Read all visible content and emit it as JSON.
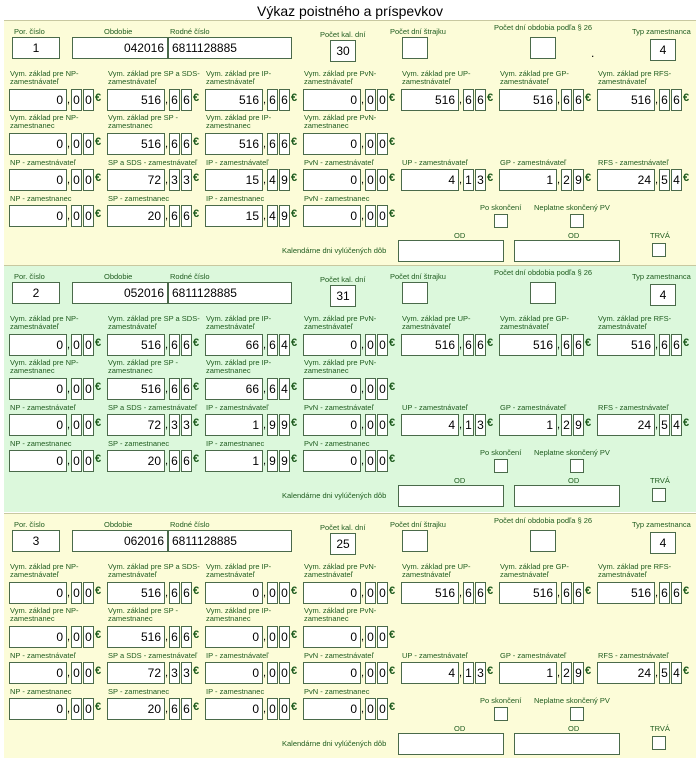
{
  "title": "Výkaz poistného a príspevkov",
  "labels": {
    "por_cislo": "Por. číslo",
    "obdobie": "Obdobie",
    "rodne_cislo": "Rodné číslo",
    "pocet_kal_dni": "Počet kal. dní",
    "pocet_dni_strajku": "Počet dní štrajku",
    "pocet_dni_26": "Počet dní obdobia podľa § 26",
    "typ_zamestnanca": "Typ zamestnanca",
    "zam_row1": [
      "Vym. základ pre NP-zamestnávateľ",
      "Vym. základ pre SP a SDS-zamestnávateľ",
      "Vym. základ pre IP-zamestnávateľ",
      "Vym. základ pre PvN-zamestnávateľ",
      "Vym. základ pre UP-zamestnávateľ",
      "Vym. základ pre GP-zamestnávateľ",
      "Vym. základ pre RFS-zamestnávateľ"
    ],
    "zam_row2": [
      "Vym. základ pre NP-zamestnanec",
      "Vym. základ pre SP - zamestnanec",
      "Vym. základ pre IP-zamestnanec",
      "Vym. základ pre PvN-zamestnanec"
    ],
    "zam_row3": [
      "NP - zamestnávateľ",
      "SP a SDS - zamestnávateľ",
      "IP - zamestnávateľ",
      "PvN - zamestnávateľ",
      "UP - zamestnávateľ",
      "GP - zamestnávateľ",
      "RFS - zamestnávateľ"
    ],
    "zam_row4": [
      "NP - zamestnanec",
      "SP - zamestnanec",
      "IP - zamestnanec",
      "PvN - zamestnanec"
    ],
    "po_skonceni": "Po skončení",
    "neplatne": "Neplatne skončený PV",
    "od": "OD",
    "trva": "TRVÁ",
    "kalendarne": "Kalendárne dni vylúčených dôb",
    "euro": "€"
  },
  "records": [
    {
      "por": "1",
      "obdobie": "042016",
      "rodne": "6811128885",
      "kal_dni": "30",
      "strajk": "",
      "dni26": "",
      "dot": ".",
      "typ": "4",
      "row1": [
        [
          "0",
          "0",
          "0"
        ],
        [
          "516",
          "6",
          "6"
        ],
        [
          "516",
          "6",
          "6"
        ],
        [
          "0",
          "0",
          "0"
        ],
        [
          "516",
          "6",
          "6"
        ],
        [
          "516",
          "6",
          "6"
        ],
        [
          "516",
          "6",
          "6"
        ]
      ],
      "row2": [
        [
          "0",
          "0",
          "0"
        ],
        [
          "516",
          "6",
          "6"
        ],
        [
          "516",
          "6",
          "6"
        ],
        [
          "0",
          "0",
          "0"
        ]
      ],
      "row3": [
        [
          "0",
          "0",
          "0"
        ],
        [
          "72",
          "3",
          "3"
        ],
        [
          "15",
          "4",
          "9"
        ],
        [
          "0",
          "0",
          "0"
        ],
        [
          "4",
          "1",
          "3"
        ],
        [
          "1",
          "2",
          "9"
        ],
        [
          "24",
          "5",
          "4"
        ]
      ],
      "row4": [
        [
          "0",
          "0",
          "0"
        ],
        [
          "20",
          "6",
          "6"
        ],
        [
          "15",
          "4",
          "9"
        ],
        [
          "0",
          "0",
          "0"
        ]
      ]
    },
    {
      "por": "2",
      "obdobie": "052016",
      "rodne": "6811128885",
      "kal_dni": "31",
      "strajk": "",
      "dni26": "",
      "dot": "",
      "typ": "4",
      "row1": [
        [
          "0",
          "0",
          "0"
        ],
        [
          "516",
          "6",
          "6"
        ],
        [
          "66",
          "6",
          "4"
        ],
        [
          "0",
          "0",
          "0"
        ],
        [
          "516",
          "6",
          "6"
        ],
        [
          "516",
          "6",
          "6"
        ],
        [
          "516",
          "6",
          "6"
        ]
      ],
      "row2": [
        [
          "0",
          "0",
          "0"
        ],
        [
          "516",
          "6",
          "6"
        ],
        [
          "66",
          "6",
          "4"
        ],
        [
          "0",
          "0",
          "0"
        ]
      ],
      "row3": [
        [
          "0",
          "0",
          "0"
        ],
        [
          "72",
          "3",
          "3"
        ],
        [
          "1",
          "9",
          "9"
        ],
        [
          "0",
          "0",
          "0"
        ],
        [
          "4",
          "1",
          "3"
        ],
        [
          "1",
          "2",
          "9"
        ],
        [
          "24",
          "5",
          "4"
        ]
      ],
      "row4": [
        [
          "0",
          "0",
          "0"
        ],
        [
          "20",
          "6",
          "6"
        ],
        [
          "1",
          "9",
          "9"
        ],
        [
          "0",
          "0",
          "0"
        ]
      ]
    },
    {
      "por": "3",
      "obdobie": "062016",
      "rodne": "6811128885",
      "kal_dni": "25",
      "strajk": "",
      "dni26": "",
      "dot": "",
      "typ": "4",
      "row1": [
        [
          "0",
          "0",
          "0"
        ],
        [
          "516",
          "6",
          "6"
        ],
        [
          "0",
          "0",
          "0"
        ],
        [
          "0",
          "0",
          "0"
        ],
        [
          "516",
          "6",
          "6"
        ],
        [
          "516",
          "6",
          "6"
        ],
        [
          "516",
          "6",
          "6"
        ]
      ],
      "row2": [
        [
          "0",
          "0",
          "0"
        ],
        [
          "516",
          "6",
          "6"
        ],
        [
          "0",
          "0",
          "0"
        ],
        [
          "0",
          "0",
          "0"
        ]
      ],
      "row3": [
        [
          "0",
          "0",
          "0"
        ],
        [
          "72",
          "3",
          "3"
        ],
        [
          "0",
          "0",
          "0"
        ],
        [
          "0",
          "0",
          "0"
        ],
        [
          "4",
          "1",
          "3"
        ],
        [
          "1",
          "2",
          "9"
        ],
        [
          "24",
          "5",
          "4"
        ]
      ],
      "row4": [
        [
          "0",
          "0",
          "0"
        ],
        [
          "20",
          "6",
          "6"
        ],
        [
          "0",
          "0",
          "0"
        ],
        [
          "0",
          "0",
          "0"
        ]
      ]
    }
  ],
  "colors": {
    "section1": "#fcfcd8",
    "section2": "#dcf8dc",
    "section3": "#fcfcd8",
    "label": "#1f5c1f",
    "border": "#4a6a4a"
  }
}
